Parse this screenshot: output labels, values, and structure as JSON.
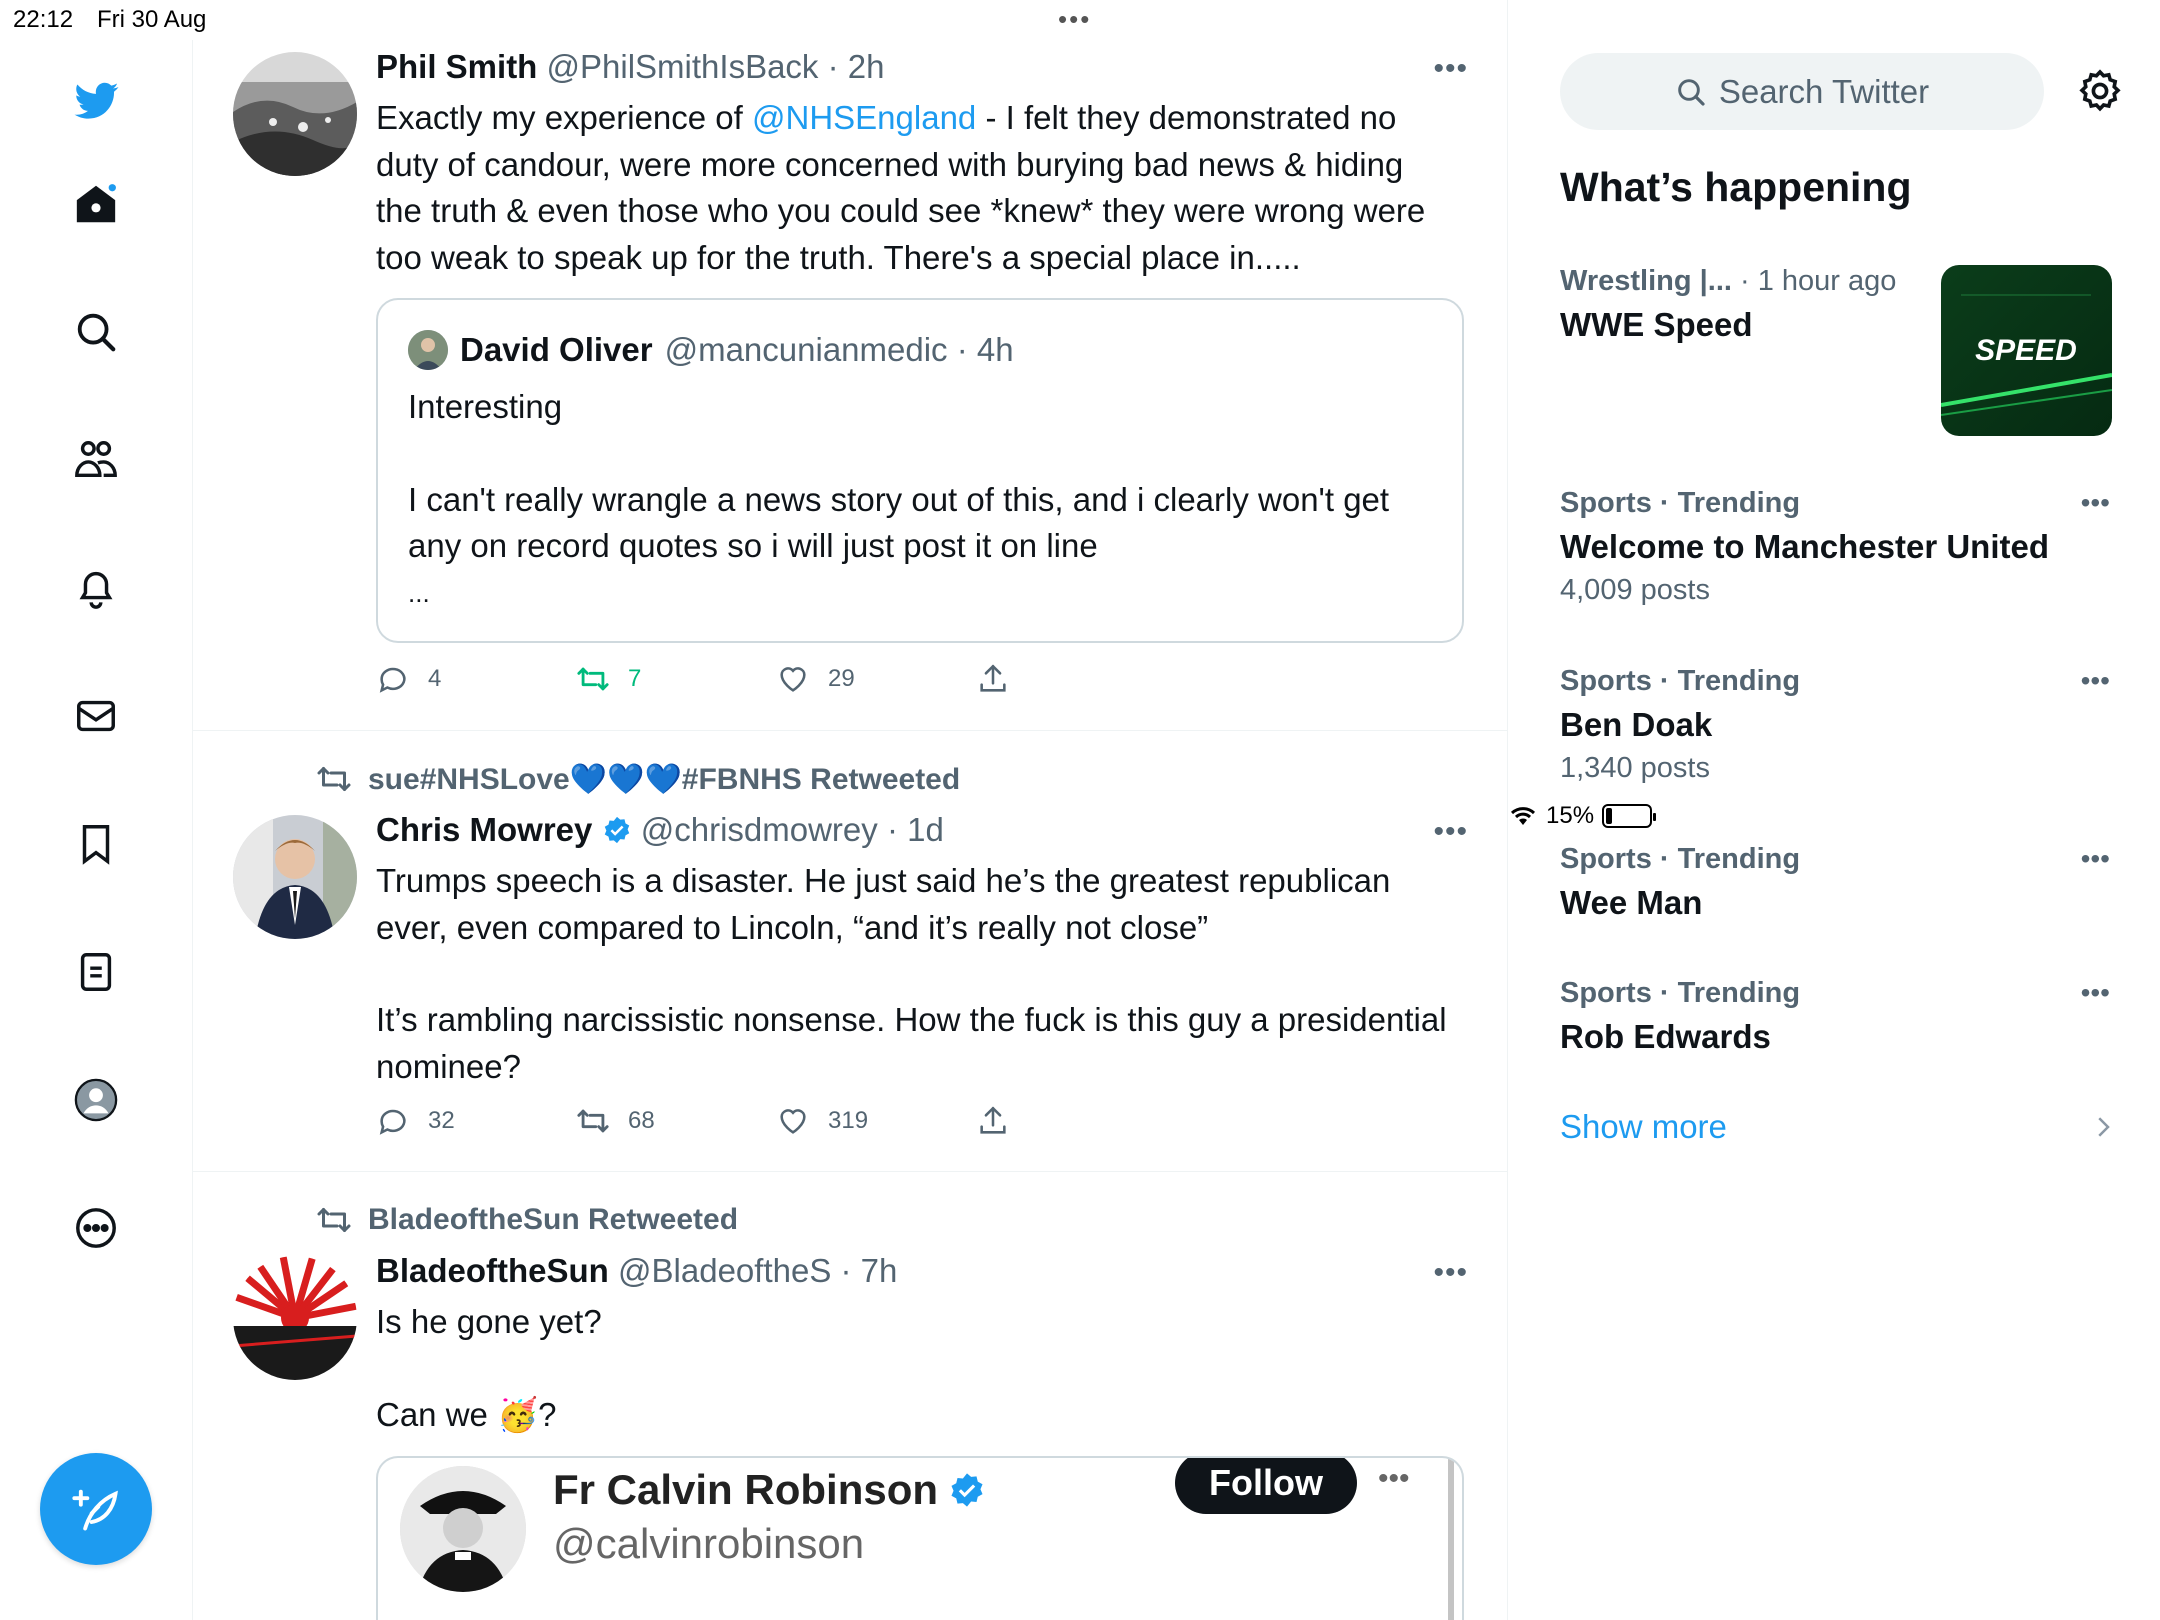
{
  "status": {
    "time": "22:12",
    "date": "Fri 30 Aug",
    "battery": "15%",
    "battery_level": 0.15
  },
  "compose": {
    "label": ""
  },
  "tweets": [
    {
      "name": "Phil Smith",
      "meta": "@PhilSmithIsBack · 2h",
      "text_before": "Exactly my experience of ",
      "mention": "@NHSEngland",
      "text_after": " - I felt they demonstrated no duty of candour, were more concerned with burying bad news & hiding the truth & even those who you could see *knew* they were wrong were too weak to speak up for the truth.  There's a special place in.....",
      "quote": {
        "name": "David Oliver",
        "meta": "@mancunianmedic · 4h",
        "line1": "Interesting",
        "line2": "I can't really wrangle a news story out of this, and i clearly won't get any on record quotes so i will just post it on line",
        "line3": "..."
      },
      "replies": "4",
      "retweets": "7",
      "likes": "29"
    },
    {
      "retweeted_by": "sue#NHSLove💙💙💙#FBNHS Retweeted",
      "name": "Chris Mowrey",
      "meta": "@chrisdmowrey · 1d",
      "para1": "Trumps speech is a disaster. He just said he’s the greatest republican ever, even compared to Lincoln, “and it’s really not close”",
      "para2": "It’s rambling narcissistic nonsense. How the fuck is this guy a presidential nominee?",
      "replies": "32",
      "retweets": "68",
      "likes": "319"
    },
    {
      "retweeted_by": "BladeoftheSun Retweeted",
      "name": "BladeoftheSun",
      "meta": "@BladeoftheS · 7h",
      "para1": "Is he gone yet?",
      "para2_a": "Can we ",
      "para2_emoji": "🥳",
      "para2_b": "?",
      "embed": {
        "name": "Fr Calvin Robinson",
        "handle": "@calvinrobinson",
        "follow": "Follow"
      }
    }
  ],
  "sidebar": {
    "search_placeholder": "Search Twitter",
    "section_title": "What’s happening",
    "trends": [
      {
        "category": "Wrestling |...",
        "ago": " · 1 hour ago",
        "title": "WWE Speed",
        "count": ""
      },
      {
        "category": "Sports · Trending",
        "title": "Welcome to Manchester United",
        "count": "4,009 posts"
      },
      {
        "category": "Sports · Trending",
        "title": "Ben Doak",
        "count": "1,340 posts"
      },
      {
        "category": "Sports · Trending",
        "title": "Wee Man",
        "count": ""
      },
      {
        "category": "Sports · Trending",
        "title": "Rob Edwards",
        "count": ""
      }
    ],
    "trend_image_text": "SPEED",
    "show_more": "Show more"
  },
  "colors": {
    "accent": "#1d9bf0",
    "retweet_green": "#00ba7c",
    "muted": "#536471"
  }
}
